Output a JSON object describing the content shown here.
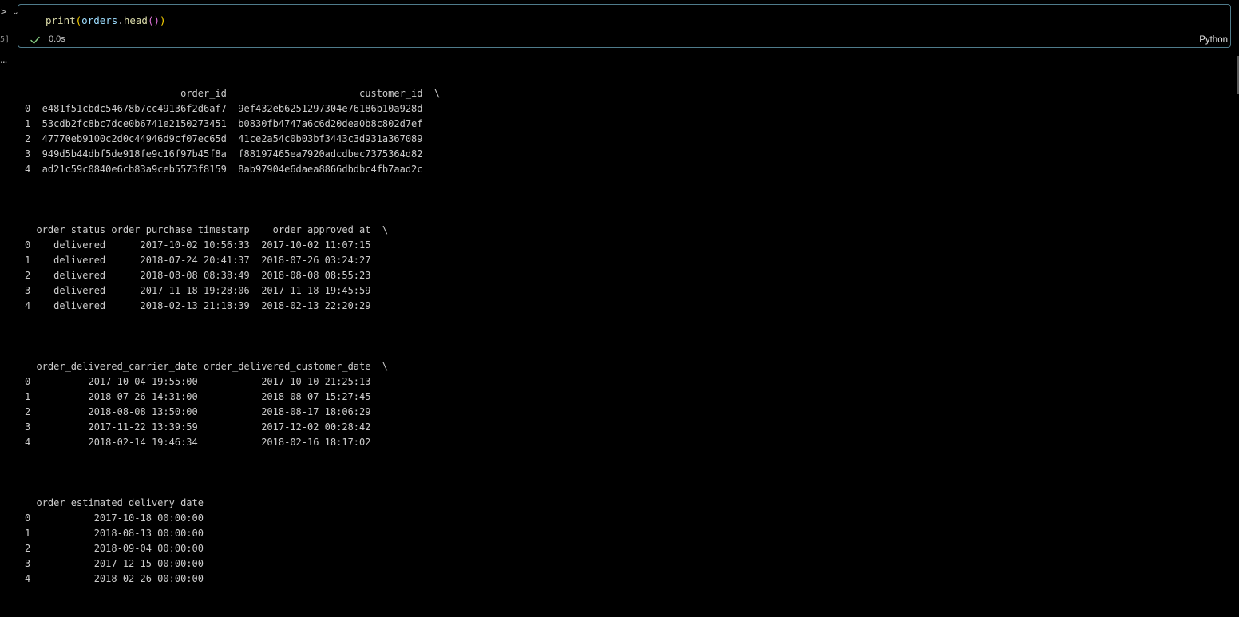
{
  "gutter": {
    "chevrons": "> ⌄",
    "exec_count": "5]",
    "output_menu": "..."
  },
  "cell": {
    "code": {
      "fn": "print",
      "open1": "(",
      "var": "orders",
      "dot": ".",
      "method": "head",
      "open2": "(",
      "close2": ")",
      "close1": ")"
    },
    "duration": "0.0s",
    "language": "Python"
  },
  "colors": {
    "cell_border": "#4f7b8b",
    "check": "#89d185",
    "background": "#000000",
    "text": "#cccccc"
  },
  "output": {
    "blocks": [
      "                           order_id                       customer_id  \\\n0  e481f51cbdc54678b7cc49136f2d6af7  9ef432eb6251297304e76186b10a928d   \n1  53cdb2fc8bc7dce0b6741e2150273451  b0830fb4747a6c6d20dea0b8c802d7ef   \n2  47770eb9100c2d0c44946d9cf07ec65d  41ce2a54c0b03bf3443c3d931a367089   \n3  949d5b44dbf5de918fe9c16f97b45f8a  f88197465ea7920adcdbec7375364d82   \n4  ad21c59c0840e6cb83a9ceb5573f8159  8ab97904e6daea8866dbdbc4fb7aad2c   ",
      "  order_status order_purchase_timestamp    order_approved_at  \\\n0    delivered      2017-10-02 10:56:33  2017-10-02 11:07:15   \n1    delivered      2018-07-24 20:41:37  2018-07-26 03:24:27   \n2    delivered      2018-08-08 08:38:49  2018-08-08 08:55:23   \n3    delivered      2017-11-18 19:28:06  2017-11-18 19:45:59   \n4    delivered      2018-02-13 21:18:39  2018-02-13 22:20:29   ",
      "  order_delivered_carrier_date order_delivered_customer_date  \\\n0          2017-10-04 19:55:00           2017-10-10 21:25:13   \n1          2018-07-26 14:31:00           2018-08-07 15:27:45   \n2          2018-08-08 13:50:00           2018-08-17 18:06:29   \n3          2017-11-22 13:39:59           2017-12-02 00:28:42   \n4          2018-02-14 19:46:34           2018-02-16 18:17:02   ",
      "  order_estimated_delivery_date\n0           2017-10-18 00:00:00\n1           2018-08-13 00:00:00\n2           2018-09-04 00:00:00\n3           2017-12-15 00:00:00\n4           2018-02-26 00:00:00"
    ]
  }
}
